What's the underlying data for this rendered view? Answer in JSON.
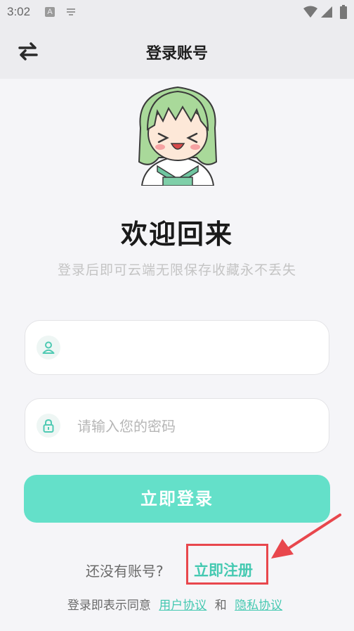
{
  "status_bar": {
    "time": "3:02",
    "notif_letter": "A"
  },
  "header": {
    "title": "登录账号",
    "switch_icon": "swap-arrows-icon"
  },
  "welcome": {
    "title": "欢迎回来",
    "subtitle": "登录后即可云端无限保存收藏永不丢失"
  },
  "form": {
    "username": {
      "value": "",
      "placeholder": "",
      "icon": "user-icon"
    },
    "password": {
      "value": "",
      "placeholder": "请输入您的密码",
      "icon": "lock-icon"
    },
    "login_label": "立即登录"
  },
  "register": {
    "question": "还没有账号?",
    "link": "立即注册"
  },
  "agreement": {
    "prefix": "登录即表示同意",
    "user_agreement": "用户协议",
    "and": "和",
    "privacy_policy": "隐私协议"
  },
  "colors": {
    "accent": "#64e0c9",
    "link": "#45c9b1",
    "annotation_red": "#e8474d"
  }
}
